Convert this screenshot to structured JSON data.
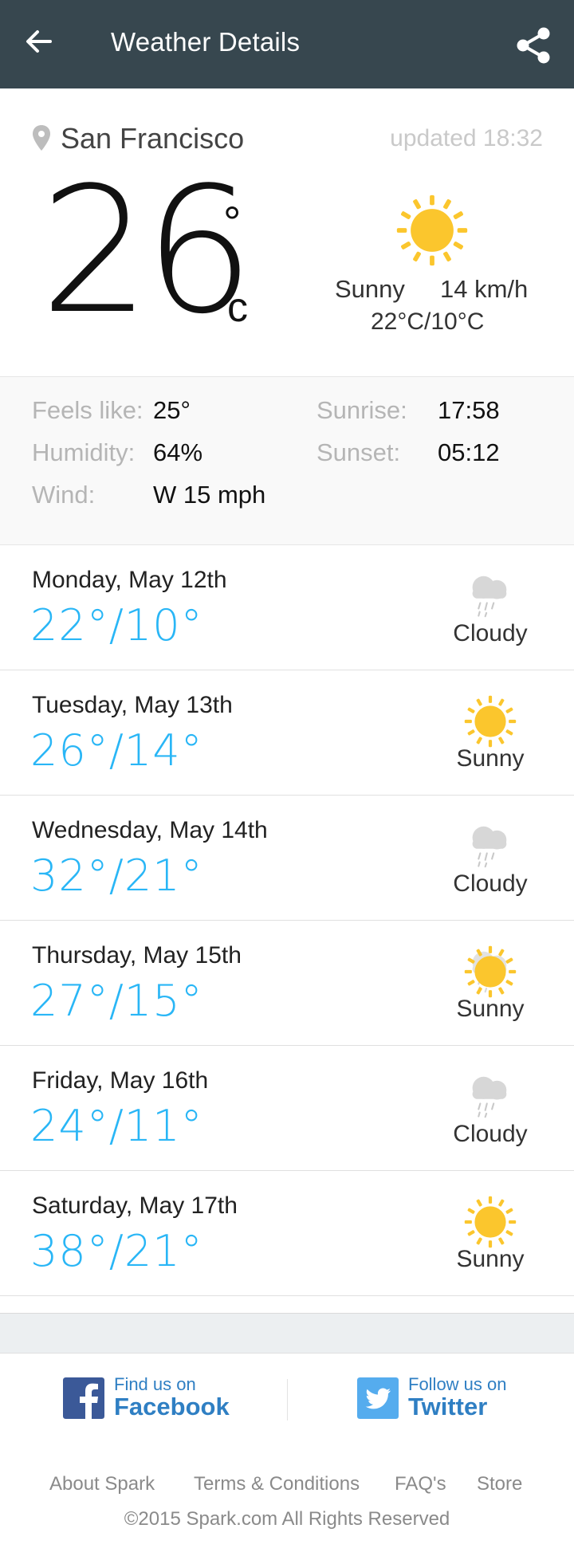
{
  "header": {
    "title": "Weather Details",
    "back_icon": "arrow-left-icon",
    "share_icon": "share-icon"
  },
  "current": {
    "location": "San Francisco",
    "updated": "updated 18:32",
    "temperature": "26",
    "degree": "°",
    "unit": "c",
    "condition": "Sunny",
    "wind_speed": "14 km/h",
    "range": "22°C/10°C",
    "icon": "sun-icon"
  },
  "details": {
    "feels_like_label": "Feels like:",
    "feels_like": "25°",
    "humidity_label": "Humidity:",
    "humidity": "64%",
    "wind_label": "Wind:",
    "wind": "W 15 mph",
    "sunrise_label": "Sunrise:",
    "sunrise": "17:58",
    "sunset_label": "Sunset:",
    "sunset": "05:12"
  },
  "forecast": [
    {
      "day": "Monday, May 12th",
      "temps": "22°/10°",
      "condition": "Cloudy",
      "icon": "cloud-rain-icon"
    },
    {
      "day": "Tuesday, May 13th",
      "temps": "26°/14°",
      "condition": "Sunny",
      "icon": "sun-icon"
    },
    {
      "day": "Wednesday, May 14th",
      "temps": "32°/21°",
      "condition": "Cloudy",
      "icon": "cloud-rain-icon"
    },
    {
      "day": "Thursday, May 15th",
      "temps": "27°/15°",
      "condition": "Sunny",
      "icon": "sun-cloud-icon"
    },
    {
      "day": "Friday, May 16th",
      "temps": "24°/11°",
      "condition": "Cloudy",
      "icon": "cloud-rain-icon"
    },
    {
      "day": "Saturday, May 17th",
      "temps": "38°/21°",
      "condition": "Sunny",
      "icon": "sun-icon"
    }
  ],
  "social": {
    "facebook_small": "Find us on",
    "facebook_big": "Facebook",
    "twitter_small": "Follow us on",
    "twitter_big": "Twitter"
  },
  "footer": {
    "links": [
      "About Spark",
      "Terms & Conditions",
      "FAQ's",
      "Store"
    ],
    "copyright": "©2015 Spark.com All Rights Reserved"
  },
  "colors": {
    "appbar": "#37474f",
    "accent": "#29b6f6",
    "sun": "#fbc62d",
    "link": "#2f7fc3"
  }
}
